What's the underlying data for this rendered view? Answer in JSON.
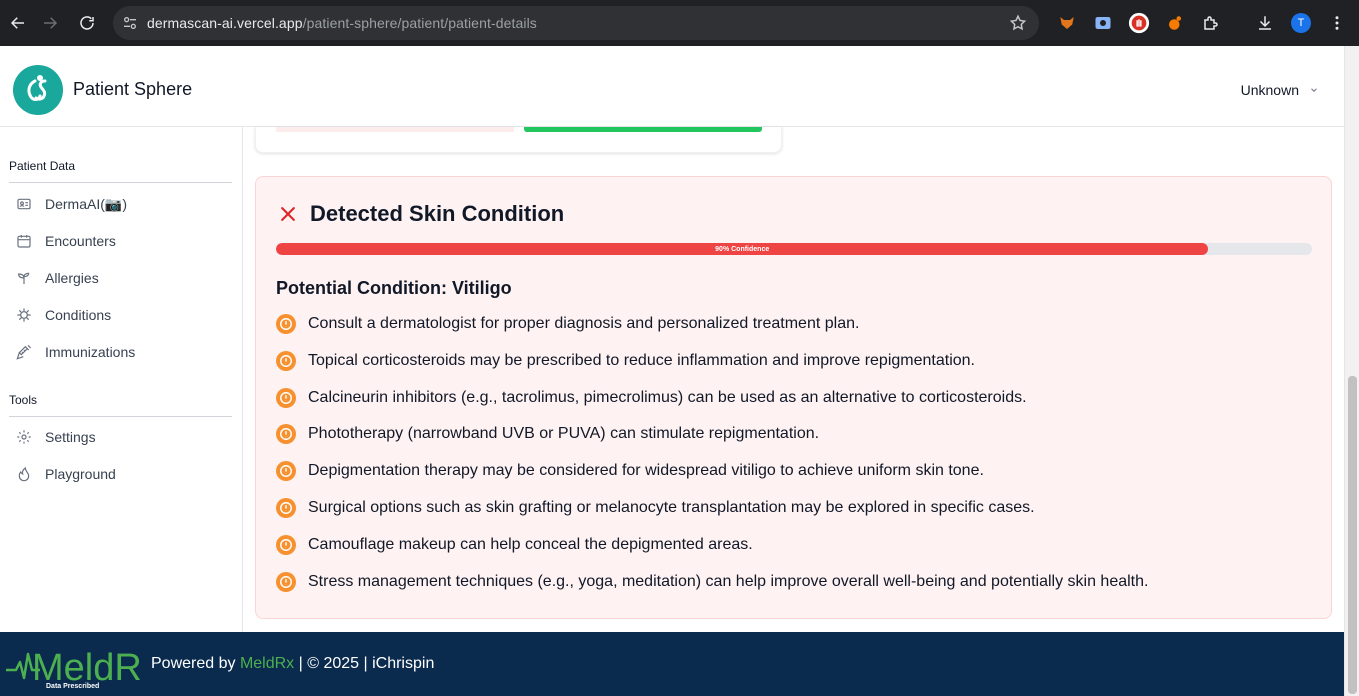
{
  "browser": {
    "url_host": "dermascan-ai.vercel.app",
    "url_path": "/patient-sphere/patient/patient-details",
    "profile_initial": "T"
  },
  "header": {
    "app_title": "Patient Sphere",
    "user_label": "Unknown"
  },
  "sidebar": {
    "section_patient": "Patient Data",
    "items": [
      {
        "label": "DermaAI(📷)",
        "icon": "id-card-icon"
      },
      {
        "label": "Encounters",
        "icon": "calendar-icon"
      },
      {
        "label": "Allergies",
        "icon": "sprout-icon"
      },
      {
        "label": "Conditions",
        "icon": "virus-icon"
      },
      {
        "label": "Immunizations",
        "icon": "syringe-icon"
      }
    ],
    "section_tools": "Tools",
    "tools": [
      {
        "label": "Settings",
        "icon": "gear-icon"
      },
      {
        "label": "Playground",
        "icon": "flame-icon"
      }
    ]
  },
  "result": {
    "title": "Detected Skin Condition",
    "confidence_label": "90% Confidence",
    "confidence_fraction": 0.9,
    "condition": "Potential Condition: Vitiligo",
    "recommendations": [
      "Consult a dermatologist for proper diagnosis and personalized treatment plan.",
      "Topical corticosteroids may be prescribed to reduce inflammation and improve repigmentation.",
      "Calcineurin inhibitors (e.g., tacrolimus, pimecrolimus) can be used as an alternative to corticosteroids.",
      "Phototherapy (narrowband UVB or PUVA) can stimulate repigmentation.",
      "Depigmentation therapy may be considered for widespread vitiligo to achieve uniform skin tone.",
      "Surgical options such as skin grafting or melanocyte transplantation may be explored in specific cases.",
      "Camouflage makeup can help conceal the depigmented areas.",
      "Stress management techniques (e.g., yoga, meditation) can help improve overall well-being and potentially skin health."
    ]
  },
  "footer": {
    "logo_text": "MeldRx",
    "logo_tagline": "Data Prescribed",
    "powered_by": "Powered by ",
    "brand": "MeldRx",
    "rest": " | © 2025 | iChrispin"
  },
  "colors": {
    "accent_teal": "#1aa89c",
    "danger": "#ef4444",
    "warning": "#f7912f",
    "footer_bg": "#0a2a4e",
    "brand_green": "#4cb050"
  }
}
